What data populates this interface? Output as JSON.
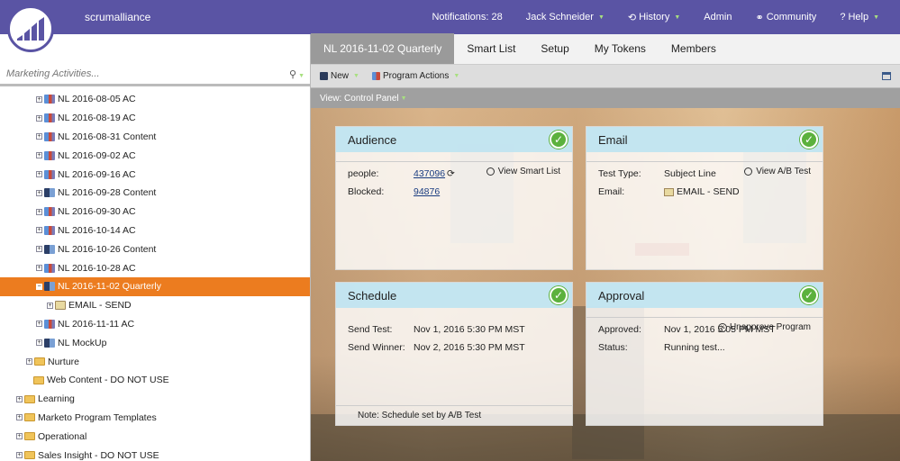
{
  "header": {
    "brand": "scrumalliance",
    "notifications": "Notifications: 28",
    "user": "Jack Schneider",
    "history": "History",
    "admin": "Admin",
    "community": "Community",
    "help": "Help"
  },
  "sidebar": {
    "search_placeholder": "Marketing Activities...",
    "items": [
      {
        "label": "NL 2016-08-05 AC",
        "indent": 40,
        "icon": "prog"
      },
      {
        "label": "NL 2016-08-19 AC",
        "indent": 40,
        "icon": "prog"
      },
      {
        "label": "NL 2016-08-31 Content",
        "indent": 40,
        "icon": "prog"
      },
      {
        "label": "NL 2016-09-02 AC",
        "indent": 40,
        "icon": "prog"
      },
      {
        "label": "NL 2016-09-16 AC",
        "indent": 40,
        "icon": "prog"
      },
      {
        "label": "NL 2016-09-28 Content",
        "indent": 40,
        "icon": "prog2"
      },
      {
        "label": "NL 2016-09-30 AC",
        "indent": 40,
        "icon": "prog"
      },
      {
        "label": "NL 2016-10-14 AC",
        "indent": 40,
        "icon": "prog"
      },
      {
        "label": "NL 2016-10-26 Content",
        "indent": 40,
        "icon": "prog2"
      },
      {
        "label": "NL 2016-10-28 AC",
        "indent": 40,
        "icon": "prog"
      },
      {
        "label": "NL 2016-11-02 Quarterly",
        "indent": 40,
        "icon": "prog2",
        "selected": true,
        "expanded": true
      },
      {
        "label": "EMAIL - SEND",
        "indent": 52,
        "icon": "email"
      },
      {
        "label": "NL 2016-11-11 AC",
        "indent": 40,
        "icon": "prog"
      },
      {
        "label": "NL MockUp",
        "indent": 40,
        "icon": "prog2"
      },
      {
        "label": "Nurture",
        "indent": 29,
        "icon": "folder"
      },
      {
        "label": "Web Content - DO NOT USE",
        "indent": 37,
        "icon": "folder",
        "noexp": true
      },
      {
        "label": "Learning",
        "indent": 18,
        "icon": "folder"
      },
      {
        "label": "Marketo Program Templates",
        "indent": 18,
        "icon": "folder"
      },
      {
        "label": "Operational",
        "indent": 18,
        "icon": "folder"
      },
      {
        "label": "Sales Insight - DO NOT USE",
        "indent": 18,
        "icon": "folder"
      }
    ]
  },
  "tabs": [
    "NL 2016-11-02 Quarterly",
    "Smart List",
    "Setup",
    "My Tokens",
    "Members"
  ],
  "toolbar": {
    "new_label": "New",
    "program_actions_label": "Program Actions",
    "view_label": "View: Control Panel"
  },
  "cards": {
    "audience": {
      "title": "Audience",
      "people_label": "people:",
      "people_value": "437096",
      "blocked_label": "Blocked:",
      "blocked_value": "94876",
      "footer": "View Smart List"
    },
    "email": {
      "title": "Email",
      "test_type_label": "Test Type:",
      "test_type_value": "Subject Line",
      "email_label": "Email:",
      "email_value": "EMAIL - SEND",
      "footer": "View A/B Test"
    },
    "schedule": {
      "title": "Schedule",
      "send_test_label": "Send Test:",
      "send_test_value": "Nov 1, 2016 5:30 PM MST",
      "send_winner_label": "Send Winner:",
      "send_winner_value": "Nov 2, 2016 5:30 PM MST",
      "footer": "Note: Schedule set by A/B Test"
    },
    "approval": {
      "title": "Approval",
      "approved_label": "Approved:",
      "approved_value": "Nov 1, 2016 5:05 PM MST",
      "status_label": "Status:",
      "status_value": "Running test...",
      "footer": "Unapprove Program"
    }
  }
}
